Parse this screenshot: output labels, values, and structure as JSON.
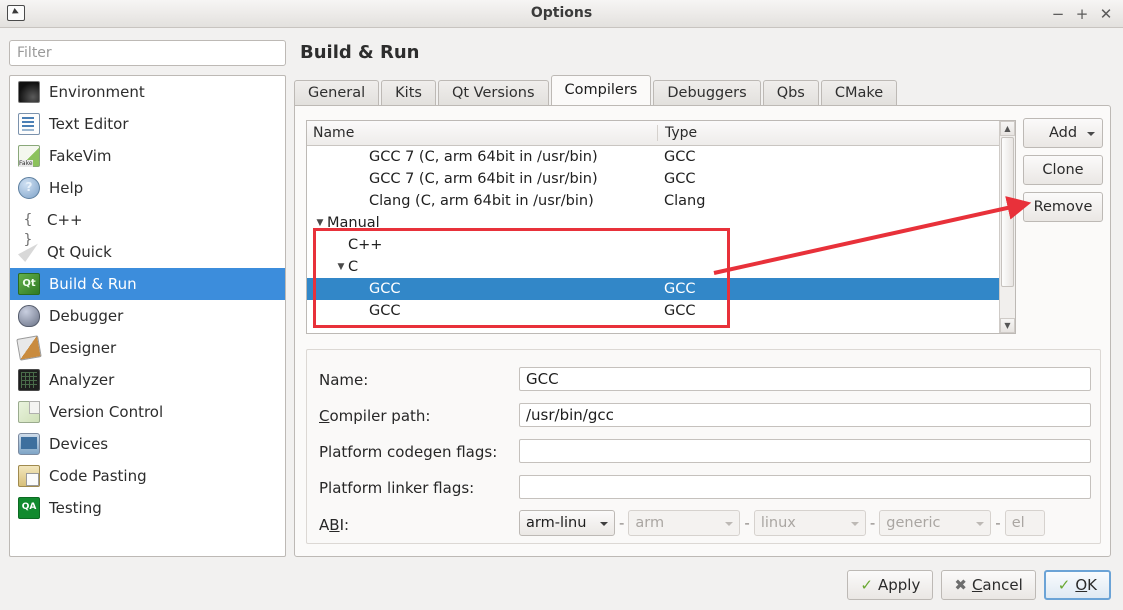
{
  "window": {
    "title": "Options",
    "icon": "app-window-icon",
    "controls": [
      {
        "name": "minimize",
        "glyph": "−"
      },
      {
        "name": "maximize",
        "glyph": "+"
      },
      {
        "name": "close",
        "glyph": "✕"
      }
    ]
  },
  "filter": {
    "placeholder": "Filter",
    "value": ""
  },
  "sidebar": {
    "selected_index": 6,
    "items": [
      {
        "label": "Environment",
        "icon": "monitor-icon",
        "cls": "ico-env"
      },
      {
        "label": "Text Editor",
        "icon": "document-text-icon",
        "cls": "ico-text"
      },
      {
        "label": "FakeVim",
        "icon": "fakevim-icon",
        "cls": "ico-fake"
      },
      {
        "label": "Help",
        "icon": "question-mark-icon",
        "cls": "ico-help"
      },
      {
        "label": "C++",
        "icon": "braces-icon",
        "cls": "ico-cpp"
      },
      {
        "label": "Qt Quick",
        "icon": "paper-plane-icon",
        "cls": "ico-qtq"
      },
      {
        "label": "Build & Run",
        "icon": "qt-build-icon",
        "cls": "ico-build"
      },
      {
        "label": "Debugger",
        "icon": "bug-icon",
        "cls": "ico-debug"
      },
      {
        "label": "Designer",
        "icon": "ruler-pencil-icon",
        "cls": "ico-design"
      },
      {
        "label": "Analyzer",
        "icon": "grid-screen-icon",
        "cls": "ico-analyze"
      },
      {
        "label": "Version Control",
        "icon": "documents-icon",
        "cls": "ico-vcs"
      },
      {
        "label": "Devices",
        "icon": "phone-device-icon",
        "cls": "ico-dev"
      },
      {
        "label": "Code Pasting",
        "icon": "clipboard-globe-icon",
        "cls": "ico-paste"
      },
      {
        "label": "Testing",
        "icon": "qa-badge-icon",
        "cls": "ico-test"
      }
    ]
  },
  "page": {
    "title": "Build & Run"
  },
  "tabs": {
    "active_index": 3,
    "items": [
      {
        "label": "General"
      },
      {
        "label": "Kits"
      },
      {
        "label": "Qt Versions"
      },
      {
        "label": "Compilers"
      },
      {
        "label": "Debuggers"
      },
      {
        "label": "Qbs"
      },
      {
        "label": "CMake"
      }
    ]
  },
  "tree": {
    "columns": [
      "Name",
      "Type"
    ],
    "selected_row_index": 6,
    "rows": [
      {
        "name": "GCC 7 (C, arm 64bit in /usr/bin)",
        "type": "GCC",
        "indent": 2,
        "twisty": "none"
      },
      {
        "name": "GCC 7 (C, arm 64bit in /usr/bin)",
        "type": "GCC",
        "indent": 2,
        "twisty": "none"
      },
      {
        "name": "Clang (C, arm 64bit in /usr/bin)",
        "type": "Clang",
        "indent": 2,
        "twisty": "none"
      },
      {
        "name": "Manual",
        "type": "",
        "indent": 0,
        "twisty": "open"
      },
      {
        "name": "C++",
        "type": "",
        "indent": 1,
        "twisty": "none"
      },
      {
        "name": "C",
        "type": "",
        "indent": 1,
        "twisty": "open"
      },
      {
        "name": "GCC",
        "type": "GCC",
        "indent": 2,
        "twisty": "none"
      },
      {
        "name": "GCC",
        "type": "GCC",
        "indent": 2,
        "twisty": "none"
      }
    ]
  },
  "side_buttons": [
    {
      "label": "Add",
      "has_menu": true
    },
    {
      "label": "Clone",
      "has_menu": false
    },
    {
      "label": "Remove",
      "has_menu": false
    }
  ],
  "form": {
    "fields": [
      {
        "label": "Name:",
        "accel": "",
        "value": "GCC",
        "kind": "text"
      },
      {
        "label": "Compiler path:",
        "accel": "C",
        "value": "/usr/bin/gcc",
        "kind": "text"
      },
      {
        "label": "Platform codegen flags:",
        "accel": "",
        "value": "",
        "kind": "text"
      },
      {
        "label": "Platform linker flags:",
        "accel": "",
        "value": "",
        "kind": "text"
      },
      {
        "label": "ABI:",
        "accel": "B",
        "value": "",
        "kind": "abi"
      }
    ],
    "abi": {
      "preset": "arm-linu",
      "parts": [
        {
          "value": "arm",
          "disabled": true
        },
        {
          "value": "linux",
          "disabled": true
        },
        {
          "value": "generic",
          "disabled": true
        },
        {
          "value": "el",
          "disabled": true
        }
      ],
      "separator": "-"
    }
  },
  "dialog_buttons": [
    {
      "label": "Apply",
      "accel": "",
      "icon": "check-icon",
      "focused": false
    },
    {
      "label": "Cancel",
      "accel": "C",
      "icon": "cross-icon",
      "focused": false
    },
    {
      "label": "OK",
      "accel": "O",
      "icon": "check-icon",
      "focused": true
    }
  ],
  "annotations": {
    "highlight_color": "#e8313a",
    "rectangle_target": "manual-compiler-subtree",
    "arrow_target": "remove-button"
  }
}
